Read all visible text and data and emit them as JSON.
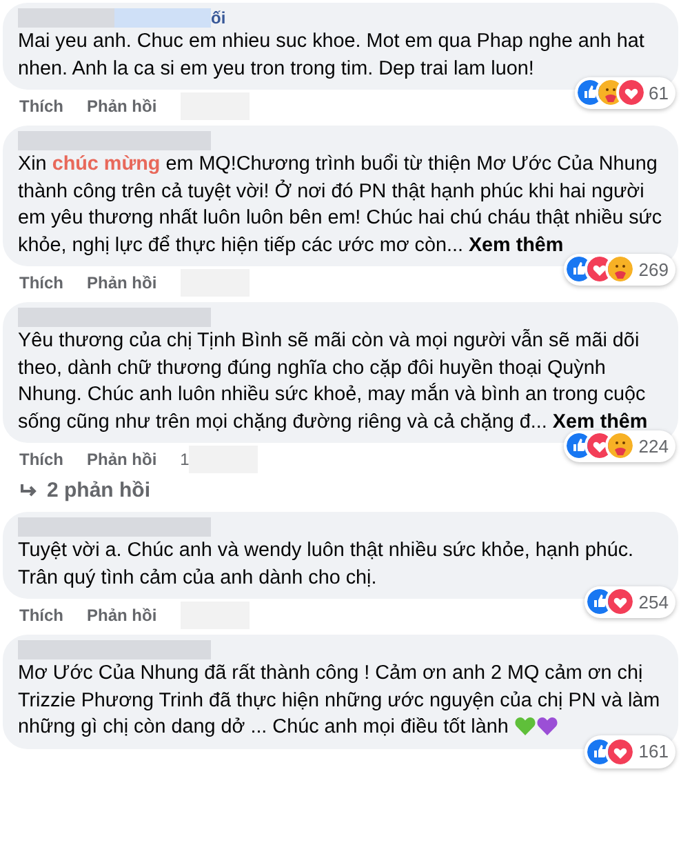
{
  "comments": [
    {
      "author_visible": "ối",
      "text": "Mai yeu anh. Chuc em nhieu suc khoe. Mot em qua Phap nghe anh hat nhen. Anh la ca si em yeu tron trong tim. Dep trai lam luon!",
      "actions": [
        "Thích",
        "Phản hồi"
      ],
      "reactions": {
        "icons": [
          {
            "kind": "like"
          },
          {
            "kind": "care"
          },
          {
            "kind": "love"
          }
        ],
        "count": "61"
      }
    },
    {
      "text": "Xin **chúc mừng** em MQ!Chương trình buổi từ thiện Mơ Ước Của Nhung thành công trên cả tuyệt vời! Ở nơi đó PN thật hạnh phúc khi hai người em yêu thương nhất luôn luôn bên em! Chúc hai chú cháu thật nhiều sức khỏe, nghị lực để thực hiện tiếp các ước mơ còn...",
      "see_more": "Xem thêm",
      "actions": [
        "Thích",
        "Phản hồi"
      ],
      "reactions": {
        "icons": [
          {
            "kind": "like"
          },
          {
            "kind": "love"
          },
          {
            "kind": "care"
          }
        ],
        "count": "269"
      }
    },
    {
      "text": "Yêu thương của chị Tịnh Bình sẽ mãi còn và mọi người vẫn sẽ mãi dõi theo, dành chữ thương đúng nghĩa cho cặp đôi huyền thoại Quỳnh Nhung. Chúc anh luôn nhiều sức khoẻ, may mắn và bình an trong cuộc sống cũng như trên mọi chặng đường riêng và cả chặng đ...",
      "see_more": "Xem thêm",
      "actions": [
        "Thích",
        "Phản hồi"
      ],
      "time": "1",
      "reactions": {
        "icons": [
          {
            "kind": "like"
          },
          {
            "kind": "love"
          },
          {
            "kind": "care"
          }
        ],
        "count": "224"
      },
      "replies": "2 phản hồi"
    },
    {
      "text": "Tuyệt vời a. Chúc anh và wendy luôn thật nhiều sức khỏe, hạnh phúc. Trân quý tình cảm của anh dành cho chị.",
      "actions": [
        "Thích",
        "Phản hồi"
      ],
      "reactions": {
        "icons": [
          {
            "kind": "like"
          },
          {
            "kind": "love"
          }
        ],
        "count": "254"
      }
    },
    {
      "text": "Mơ Ước Của Nhung đã rất thành công ! Cảm ơn anh 2 MQ cảm ơn chị Trizzie Phương Trinh đã thực hiện những ước nguyện của chị PN và làm những gì chị còn dang dở ... Chúc anh mọi điều tốt lành",
      "hearts": [
        {
          "color": "#5fbf3a"
        },
        {
          "color": "#9b4fd6"
        }
      ],
      "reactions": {
        "icons": [
          {
            "kind": "like"
          },
          {
            "kind": "love"
          }
        ],
        "count": "161"
      }
    }
  ]
}
